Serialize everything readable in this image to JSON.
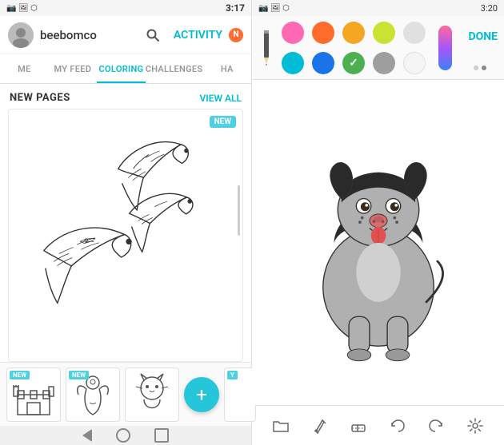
{
  "left": {
    "statusBar": {
      "left": "●",
      "icons": "▲ ▼ ◉",
      "time": "3:17"
    },
    "topBar": {
      "username": "beebomco",
      "activityLabel": "ACTIVITY",
      "notificationCount": "N"
    },
    "navTabs": [
      {
        "label": "ME",
        "active": false
      },
      {
        "label": "MY FEED",
        "active": false
      },
      {
        "label": "COLORING",
        "active": true
      },
      {
        "label": "CHALLENGES",
        "active": false
      },
      {
        "label": "HA",
        "active": false
      }
    ],
    "sectionTitle": "NEW PAGES",
    "viewAllLabel": "VIEW ALL",
    "mainBadge": "NEW",
    "thumbnails": [
      {
        "badge": "NEW"
      },
      {
        "badge": "NEW"
      },
      {}
    ],
    "addBtn": "+"
  },
  "right": {
    "statusBar": {
      "icons": "▲ ▼ ◉",
      "time": "3:20"
    },
    "toolbar": {
      "doneLabel": "DONE",
      "colors": [
        {
          "hex": "#ff69b4",
          "row": 0,
          "col": 0
        },
        {
          "hex": "#ff6b2b",
          "row": 0,
          "col": 1
        },
        {
          "hex": "#f5a623",
          "row": 0,
          "col": 2
        },
        {
          "hex": "#c8e332",
          "row": 0,
          "col": 3
        },
        {
          "hex": "#e0e0e0",
          "row": 0,
          "col": 4
        },
        {
          "hex": "#00bcd4",
          "row": 1,
          "col": 0
        },
        {
          "hex": "#1a73e8",
          "row": 1,
          "col": 1
        },
        {
          "hex": "#4caf50",
          "row": 1,
          "col": 2,
          "selected": true
        },
        {
          "hex": "#9e9e9e",
          "row": 1,
          "col": 3
        },
        {
          "hex": "#e0e0e0",
          "row": 1,
          "col": 4
        }
      ]
    },
    "bottomTools": [
      {
        "name": "folder-icon",
        "icon": "📁"
      },
      {
        "name": "fill-icon",
        "icon": "🪣"
      },
      {
        "name": "eraser-icon",
        "icon": "⬜"
      },
      {
        "name": "undo-icon",
        "icon": "↩"
      },
      {
        "name": "redo-icon",
        "icon": "↪"
      },
      {
        "name": "settings-icon",
        "icon": "⚙"
      }
    ]
  }
}
